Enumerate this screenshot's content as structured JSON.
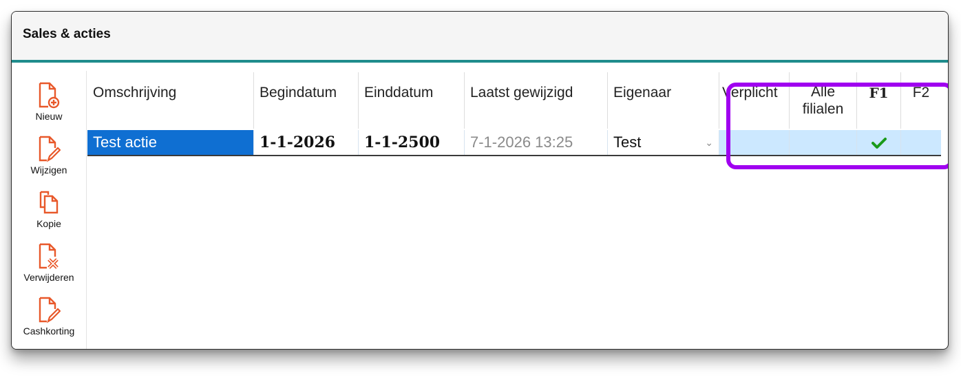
{
  "window": {
    "title": "Sales & acties"
  },
  "toolbar": {
    "items": [
      {
        "label": "Nieuw",
        "icon": "new-document-icon"
      },
      {
        "label": "Wijzigen",
        "icon": "edit-document-icon"
      },
      {
        "label": "Kopie",
        "icon": "copy-document-icon"
      },
      {
        "label": "Verwijderen",
        "icon": "delete-document-icon"
      },
      {
        "label": "Cashkorting",
        "icon": "edit-document-icon"
      }
    ]
  },
  "table": {
    "columns": {
      "omschrijving": "Omschrijving",
      "begindatum": "Begindatum",
      "einddatum": "Einddatum",
      "laatst": "Laatst gewijzigd",
      "eigenaar": "Eigenaar",
      "verplicht": "Verplicht",
      "alle_line1": "Alle",
      "alle_line2": "filialen",
      "f1": "F1",
      "f2": "F2"
    },
    "rows": [
      {
        "omschrijving": "Test actie",
        "begindatum": "1-1-2026",
        "einddatum": "1-1-2500",
        "laatst": "7-1-2026 13:25",
        "eigenaar": "Test",
        "verplicht": "",
        "alle_filialen": "",
        "f1_checked": true,
        "f2": ""
      }
    ]
  },
  "colors": {
    "accent_teal": "#1e8c8c",
    "icon_orange": "#e8582a",
    "selection_blue": "#0f6fd2",
    "row_blue": "#cce8ff",
    "highlight_purple": "#a000f0",
    "check_green": "#1a9a1a"
  }
}
